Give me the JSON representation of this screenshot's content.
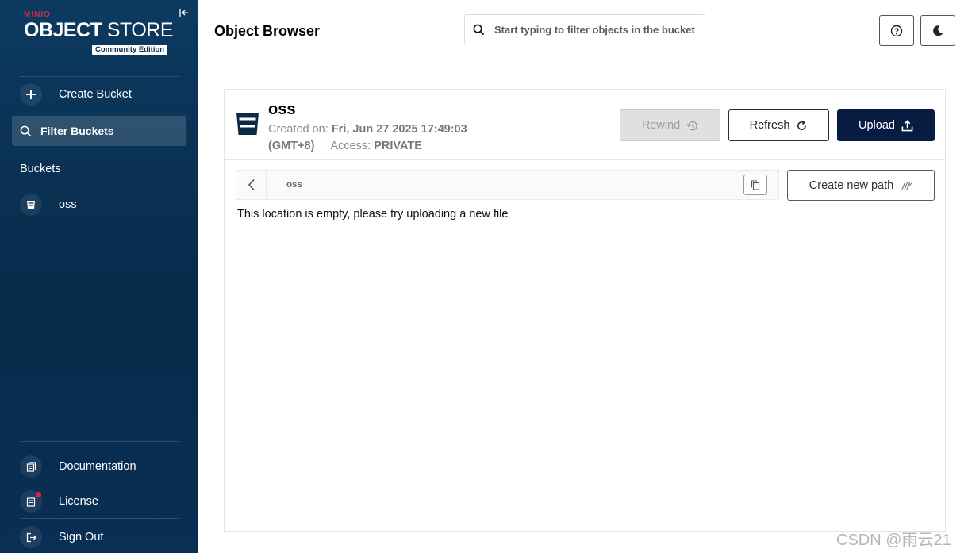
{
  "sidebar": {
    "brand": {
      "vendor": "MINIO",
      "product_bold": "OBJECT",
      "product_light": " STORE",
      "edition": "Community Edition"
    },
    "create_bucket": "Create Bucket",
    "filter_buckets": "Filter Buckets",
    "buckets_heading": "Buckets",
    "buckets": [
      {
        "name": "oss"
      }
    ],
    "footer": {
      "documentation": "Documentation",
      "license": "License",
      "sign_out": "Sign Out"
    }
  },
  "header": {
    "title": "Object Browser",
    "search_placeholder": "Start typing to filter objects in the bucket"
  },
  "bucket": {
    "name": "oss",
    "created_label": "Created on:",
    "created_value": "Fri, Jun 27 2025 17:49:03",
    "timezone": "(GMT+8)",
    "access_label": "Access:",
    "access_value": "PRIVATE"
  },
  "actions": {
    "rewind": "Rewind",
    "refresh": "Refresh",
    "upload": "Upload"
  },
  "path": {
    "crumb": "oss",
    "create_new_path": "Create new path"
  },
  "empty_message": "This location is empty, please try uploading a new file",
  "watermark": "CSDN @雨云21",
  "colors": {
    "sidebar": "#0c3a60",
    "accent": "#081c42",
    "brand_red": "#c72e49"
  }
}
